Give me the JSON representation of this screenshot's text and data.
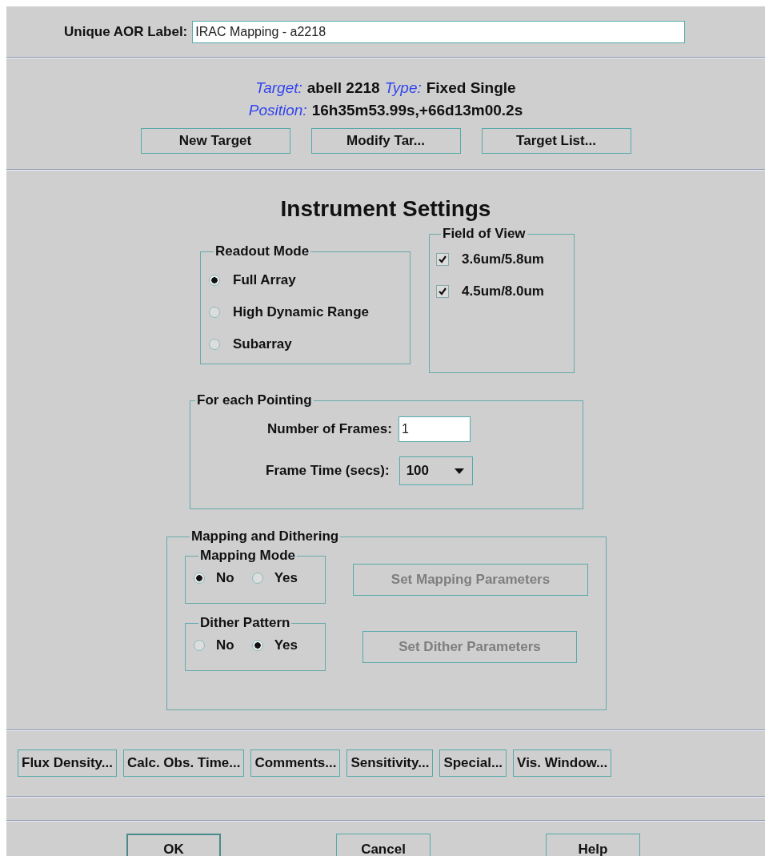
{
  "aor_label": {
    "label": "Unique AOR Label:",
    "value": "IRAC Mapping - a2218"
  },
  "target": {
    "target_label": "Target:",
    "target_value": "abell 2218",
    "type_label": "Type:",
    "type_value": "Fixed Single",
    "position_label": "Position:",
    "position_value": "16h35m53.99s,+66d13m00.2s",
    "buttons": [
      "New Target",
      "Modify Tar...",
      "Target List..."
    ]
  },
  "title": "Instrument Settings",
  "readout_mode": {
    "title": "Readout Mode",
    "options": [
      {
        "label": "Full Array",
        "selected": true
      },
      {
        "label": "High Dynamic Range",
        "selected": false
      },
      {
        "label": "Subarray",
        "selected": false
      }
    ]
  },
  "field_of_view": {
    "title": "Field of View",
    "options": [
      {
        "label": "3.6um/5.8um",
        "checked": true
      },
      {
        "label": "4.5um/8.0um",
        "checked": true
      }
    ]
  },
  "pointing": {
    "title": "For each Pointing",
    "frames_label": "Number of Frames:",
    "frames_value": "1",
    "frame_time_label": "Frame Time (secs):",
    "frame_time_value": "100"
  },
  "mapping": {
    "title": "Mapping and Dithering",
    "groups": [
      {
        "title": "Mapping Mode",
        "options": [
          {
            "label": "No",
            "selected": true
          },
          {
            "label": "Yes",
            "selected": false
          }
        ],
        "button": {
          "label": "Set Mapping Parameters",
          "disabled": true
        }
      },
      {
        "title": "Dither Pattern",
        "options": [
          {
            "label": "No",
            "selected": false
          },
          {
            "label": "Yes",
            "selected": true
          }
        ],
        "button": {
          "label": "Set Dither Parameters",
          "disabled": true
        }
      }
    ]
  },
  "tool_buttons": [
    "Flux Density...",
    "Calc. Obs. Time...",
    "Comments...",
    "Sensitivity...",
    "Special...",
    "Vis. Window..."
  ],
  "dialog_buttons": [
    {
      "label": "OK",
      "default": true
    },
    {
      "label": "Cancel",
      "default": false
    },
    {
      "label": "Help",
      "default": false
    }
  ]
}
